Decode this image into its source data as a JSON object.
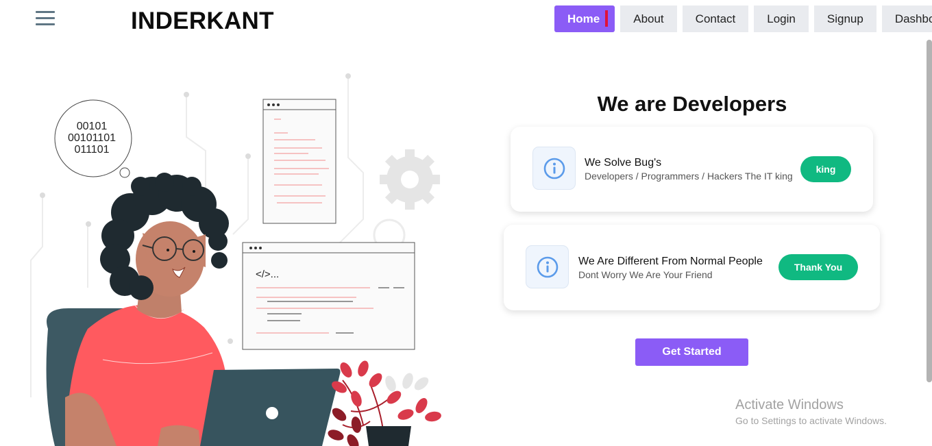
{
  "header": {
    "brand": "INDERKANT",
    "menu_icon": "hamburger-icon",
    "nav": [
      {
        "label": "Home",
        "active": true
      },
      {
        "label": "About"
      },
      {
        "label": "Contact"
      },
      {
        "label": "Login"
      },
      {
        "label": "Signup"
      },
      {
        "label": "Dashboard"
      }
    ]
  },
  "hero": {
    "title": "We are Developers",
    "cards": [
      {
        "icon": "info-icon",
        "title": "We Solve Bug's",
        "subtitle": "Developers / Programmers / Hackers The IT king",
        "button": "king"
      },
      {
        "icon": "info-icon",
        "title": "We Are Different From Normal People",
        "subtitle": "Dont Worry We Are Your Friend",
        "button": "Thank You"
      }
    ],
    "cta": "Get Started"
  },
  "illustration": {
    "binary": [
      "00101",
      "00101101",
      "011101"
    ],
    "code_tag": "</>..."
  },
  "watermark": {
    "line1": "Activate Windows",
    "line2": "Go to Settings to activate Windows."
  },
  "colors": {
    "accent": "#8b5cf6",
    "success": "#10b981",
    "nav_bg": "#e9ebef",
    "shirt": "#ff5a5f",
    "laptop": "#37545e"
  }
}
